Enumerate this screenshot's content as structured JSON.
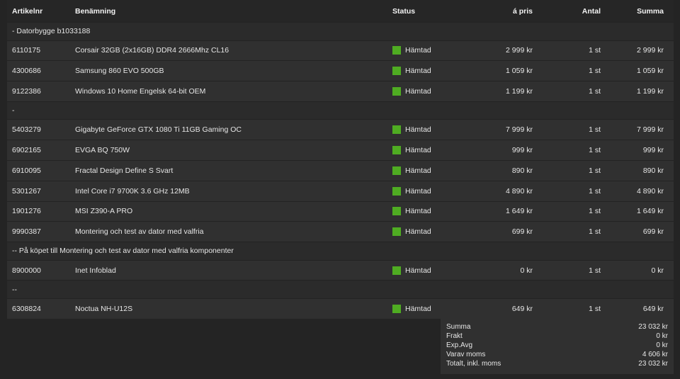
{
  "columns": {
    "article": "Artikelnr",
    "name": "Benämning",
    "status": "Status",
    "unit_price": "á pris",
    "qty": "Antal",
    "total": "Summa"
  },
  "status_color": "#4fac22",
  "rows": [
    {
      "type": "group",
      "text": "- Datorbygge b1033188"
    },
    {
      "type": "item",
      "article": "6110175",
      "name": "Corsair 32GB (2x16GB) DDR4 2666Mhz CL16",
      "status": "Hämtad",
      "price": "2 999 kr",
      "qty": "1 st",
      "total": "2 999 kr"
    },
    {
      "type": "item",
      "article": "4300686",
      "name": "Samsung 860 EVO 500GB",
      "status": "Hämtad",
      "price": "1 059 kr",
      "qty": "1 st",
      "total": "1 059 kr"
    },
    {
      "type": "item",
      "article": "9122386",
      "name": "Windows 10 Home Engelsk 64-bit OEM",
      "status": "Hämtad",
      "price": "1 199 kr",
      "qty": "1 st",
      "total": "1 199 kr"
    },
    {
      "type": "group",
      "text": "-"
    },
    {
      "type": "item",
      "article": "5403279",
      "name": "Gigabyte GeForce GTX 1080 Ti 11GB Gaming OC",
      "status": "Hämtad",
      "price": "7 999 kr",
      "qty": "1 st",
      "total": "7 999 kr"
    },
    {
      "type": "item",
      "article": "6902165",
      "name": "EVGA BQ 750W",
      "status": "Hämtad",
      "price": "999 kr",
      "qty": "1 st",
      "total": "999 kr"
    },
    {
      "type": "item",
      "article": "6910095",
      "name": "Fractal Design Define S Svart",
      "status": "Hämtad",
      "price": "890 kr",
      "qty": "1 st",
      "total": "890 kr"
    },
    {
      "type": "item",
      "article": "5301267",
      "name": "Intel Core i7 9700K 3.6 GHz 12MB",
      "status": "Hämtad",
      "price": "4 890 kr",
      "qty": "1 st",
      "total": "4 890 kr"
    },
    {
      "type": "item",
      "article": "1901276",
      "name": "MSI Z390-A PRO",
      "status": "Hämtad",
      "price": "1 649 kr",
      "qty": "1 st",
      "total": "1 649 kr"
    },
    {
      "type": "item",
      "article": "9990387",
      "name": "Montering och test av dator med valfria",
      "status": "Hämtad",
      "price": "699 kr",
      "qty": "1 st",
      "total": "699 kr"
    },
    {
      "type": "group",
      "text": "-- På köpet till Montering och test av dator med valfria komponenter"
    },
    {
      "type": "item",
      "article": "8900000",
      "name": "Inet Infoblad",
      "status": "Hämtad",
      "price": "0 kr",
      "qty": "1 st",
      "total": "0 kr"
    },
    {
      "type": "group",
      "text": "--"
    },
    {
      "type": "item",
      "article": "6308824",
      "name": "Noctua NH-U12S",
      "status": "Hämtad",
      "price": "649 kr",
      "qty": "1 st",
      "total": "649 kr"
    }
  ],
  "summary": [
    {
      "label": "Summa",
      "value": "23 032 kr"
    },
    {
      "label": "Frakt",
      "value": "0 kr"
    },
    {
      "label": "Exp.Avg",
      "value": "0 kr"
    },
    {
      "label": "Varav moms",
      "value": "4 606 kr"
    },
    {
      "label": "Totalt, inkl. moms",
      "value": "23 032 kr"
    }
  ]
}
